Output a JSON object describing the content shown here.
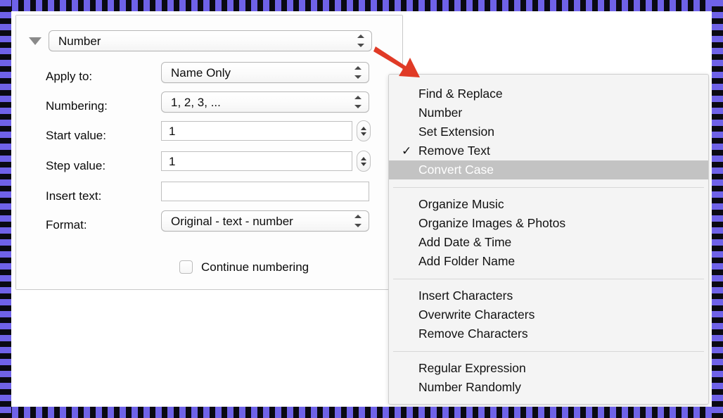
{
  "settings_panel": {
    "disclosure": {
      "icon": "disclosure-triangle-down-icon",
      "action_label": "Number"
    },
    "rows": [
      {
        "label": "Apply to:",
        "control": "popup",
        "value": "Name Only"
      },
      {
        "label": "Numbering:",
        "control": "popup",
        "value": "1, 2, 3, ..."
      },
      {
        "label": "Start value:",
        "control": "stepper",
        "value": "1"
      },
      {
        "label": "Step value:",
        "control": "stepper",
        "value": "1"
      },
      {
        "label": "Insert text:",
        "control": "textfield",
        "value": ""
      },
      {
        "label": "Format:",
        "control": "popup",
        "value": "Original - text - number"
      }
    ],
    "checkbox": {
      "label": "Continue numbering",
      "checked": false
    }
  },
  "annotation": {
    "arrow_icon": "red-arrow-pointing-down-right-icon",
    "arrow_color": "#e03a26"
  },
  "dropdown_menu": {
    "highlight_color": "#c3c3c3",
    "groups": [
      {
        "items": [
          {
            "label": "Find & Replace",
            "checked": false,
            "highlighted": false
          },
          {
            "label": "Number",
            "checked": false,
            "highlighted": false
          },
          {
            "label": "Set Extension",
            "checked": false,
            "highlighted": false
          },
          {
            "label": "Remove Text",
            "checked": true,
            "highlighted": false
          },
          {
            "label": "Convert Case",
            "checked": false,
            "highlighted": true
          }
        ]
      },
      {
        "items": [
          {
            "label": "Organize Music",
            "checked": false,
            "highlighted": false
          },
          {
            "label": "Organize Images & Photos",
            "checked": false,
            "highlighted": false
          },
          {
            "label": "Add Date & Time",
            "checked": false,
            "highlighted": false
          },
          {
            "label": "Add Folder Name",
            "checked": false,
            "highlighted": false
          }
        ]
      },
      {
        "items": [
          {
            "label": "Insert Characters",
            "checked": false,
            "highlighted": false
          },
          {
            "label": "Overwrite Characters",
            "checked": false,
            "highlighted": false
          },
          {
            "label": "Remove Characters",
            "checked": false,
            "highlighted": false
          }
        ]
      },
      {
        "items": [
          {
            "label": "Regular Expression",
            "checked": false,
            "highlighted": false
          },
          {
            "label": "Number Randomly",
            "checked": false,
            "highlighted": false
          }
        ]
      }
    ],
    "check_glyph": "✓"
  },
  "frame": {
    "stripe_color_a": "#6f62e8",
    "stripe_color_b": "#0a0a12"
  }
}
